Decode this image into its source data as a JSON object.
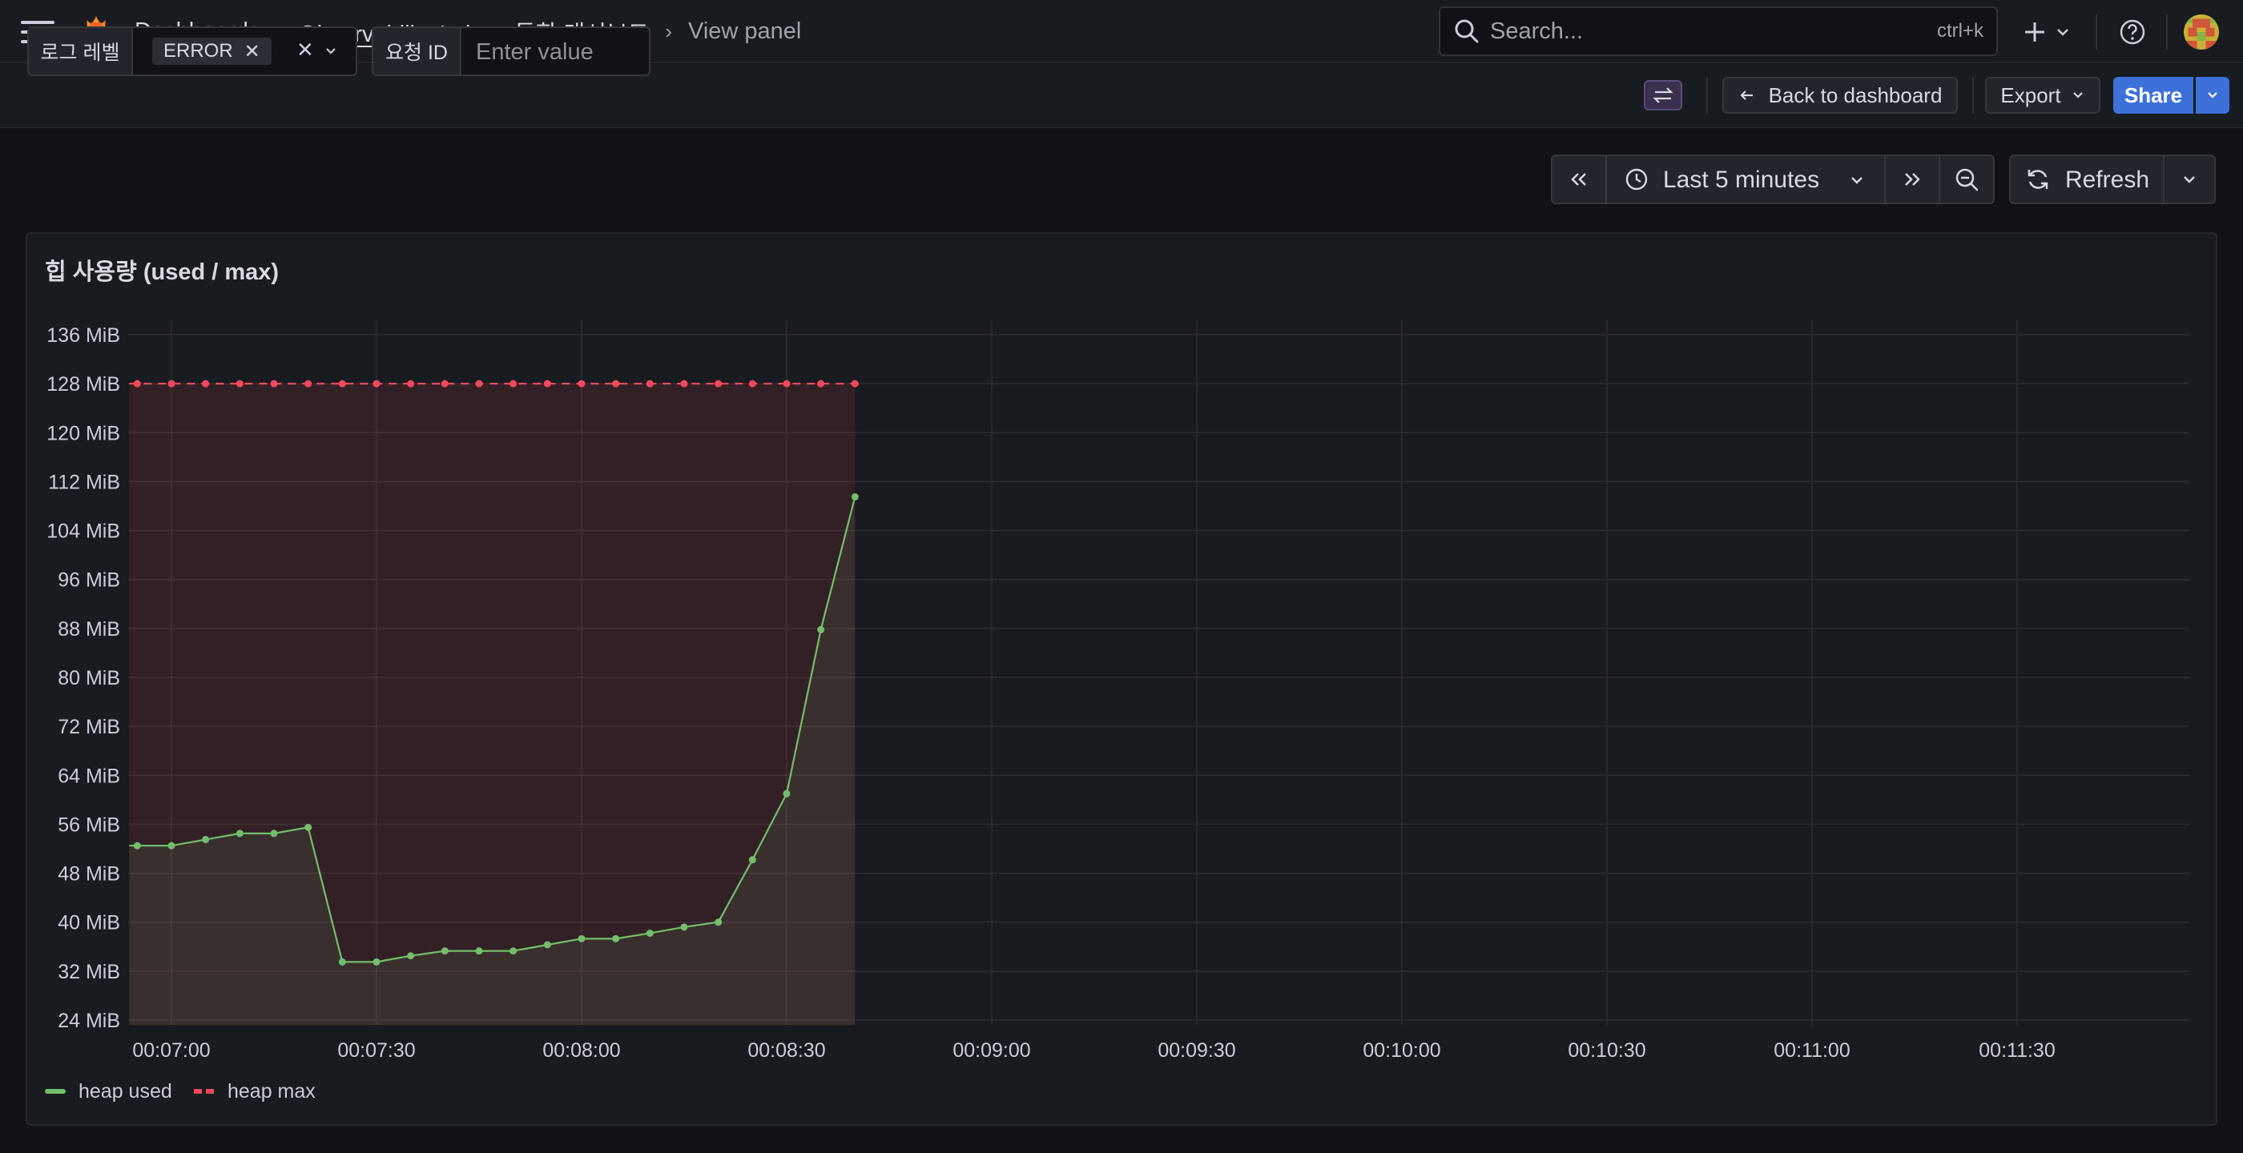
{
  "header": {
    "breadcrumb": [
      "Dashboards",
      "Observability Lab — 통합 대시보드",
      "View panel"
    ],
    "search_placeholder": "Search...",
    "search_shortcut": "ctrl+k",
    "icons": [
      "menu-icon",
      "grafana-logo",
      "search-icon",
      "plus-icon",
      "chevron-down-icon",
      "help-icon",
      "avatar"
    ]
  },
  "toolbar": {
    "back_label": "Back to dashboard",
    "export_label": "Export",
    "share_label": "Share"
  },
  "variables": {
    "log_level": {
      "label": "로그 레벨",
      "value": "ERROR"
    },
    "request_id": {
      "label": "요청 ID",
      "placeholder": "Enter value"
    }
  },
  "time_picker": {
    "range_label": "Last 5 minutes",
    "refresh_label": "Refresh"
  },
  "panel": {
    "title": "힙 사용량 (used / max)"
  },
  "colors": {
    "used": "#73bf69",
    "max": "#f2495c",
    "primary": "#3d71d9"
  },
  "chart_data": {
    "type": "line",
    "title": "힙 사용량 (used / max)",
    "y_unit": "MiB",
    "ylim": [
      24,
      136
    ],
    "y_ticks": [
      "24 MiB",
      "32 MiB",
      "40 MiB",
      "48 MiB",
      "56 MiB",
      "64 MiB",
      "72 MiB",
      "80 MiB",
      "88 MiB",
      "96 MiB",
      "104 MiB",
      "112 MiB",
      "120 MiB",
      "128 MiB",
      "136 MiB"
    ],
    "x_ticks": [
      "00:07:00",
      "00:07:30",
      "00:08:00",
      "00:08:30",
      "00:09:00",
      "00:09:30",
      "00:10:00",
      "00:10:30",
      "00:11:00",
      "00:11:30"
    ],
    "grid": true,
    "legend_position": "bottom-left",
    "x": [
      "00:06:55",
      "00:07:00",
      "00:07:05",
      "00:07:10",
      "00:07:15",
      "00:07:20",
      "00:07:25",
      "00:07:30",
      "00:07:35",
      "00:07:40",
      "00:07:45",
      "00:07:50",
      "00:07:55",
      "00:08:00",
      "00:08:05",
      "00:08:10",
      "00:08:15",
      "00:08:20",
      "00:08:25",
      "00:08:30",
      "00:08:35",
      "00:08:40"
    ],
    "series": [
      {
        "name": "heap used",
        "style": "solid",
        "values": [
          52.5,
          52.5,
          53.5,
          54.5,
          54.5,
          55.5,
          33.5,
          33.5,
          34.5,
          35.3,
          35.3,
          35.3,
          36.3,
          37.3,
          37.3,
          38.2,
          39.2,
          40.0,
          50.2,
          61.0,
          87.8,
          109.5
        ]
      },
      {
        "name": "heap max",
        "style": "dashed",
        "values": [
          128,
          128,
          128,
          128,
          128,
          128,
          128,
          128,
          128,
          128,
          128,
          128,
          128,
          128,
          128,
          128,
          128,
          128,
          128,
          128,
          128,
          128
        ]
      }
    ]
  }
}
